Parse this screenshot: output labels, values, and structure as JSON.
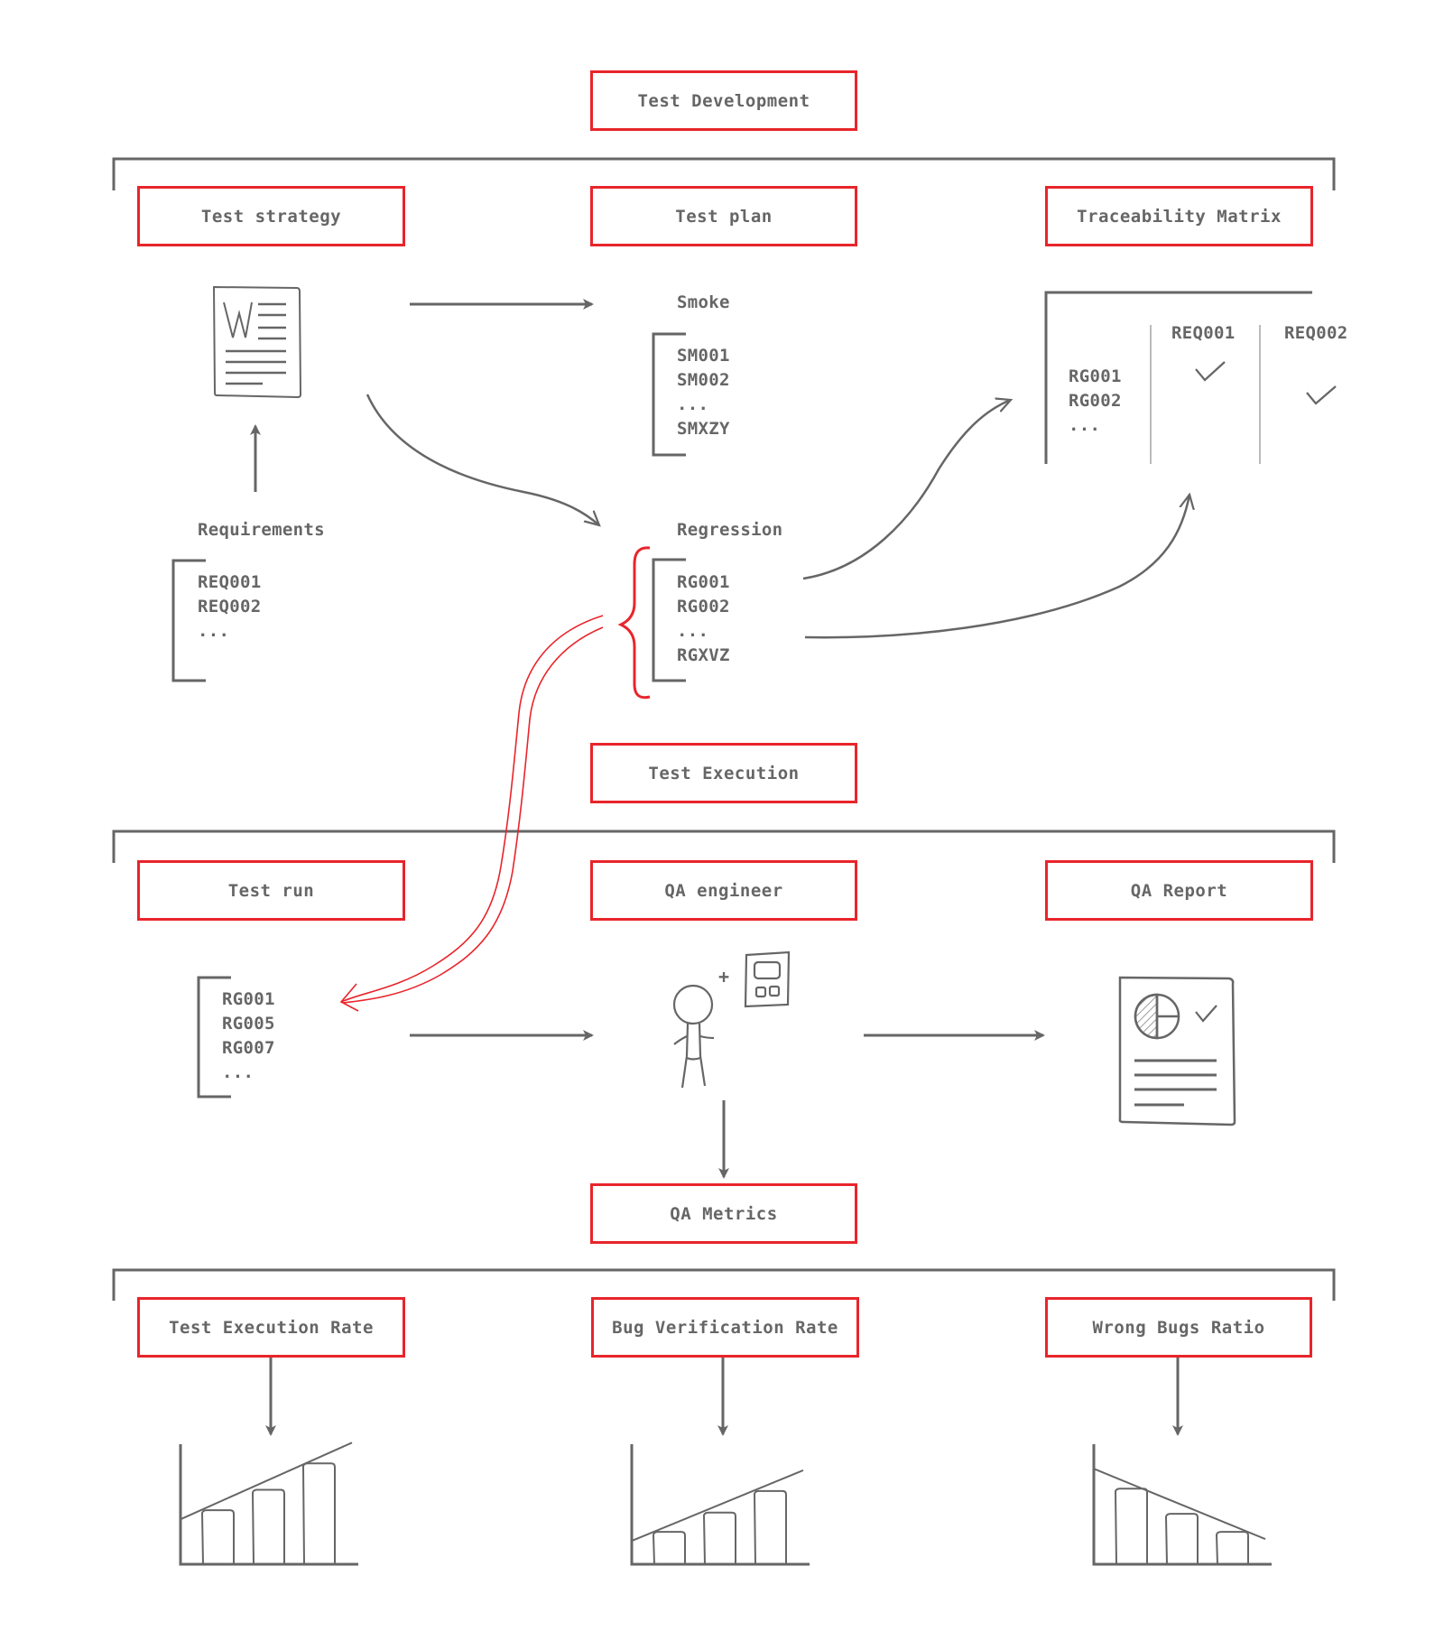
{
  "colors": {
    "accent": "#e8252b",
    "ink": "#666666",
    "light_ink": "#bbbbbb"
  },
  "sections": {
    "test_development": {
      "label": "Test Development"
    },
    "test_execution": {
      "label": "Test Execution"
    },
    "qa_metrics": {
      "label": "QA Metrics"
    }
  },
  "development": {
    "test_strategy": {
      "label": "Test strategy",
      "icon": "word-document-icon"
    },
    "test_plan": {
      "label": "Test plan"
    },
    "traceability_matrix": {
      "label": "Traceability Matrix"
    },
    "requirements": {
      "title": "Requirements",
      "items": [
        "REQ001",
        "REQ002",
        "..."
      ]
    },
    "smoke": {
      "title": "Smoke",
      "items": [
        "SM001",
        "SM002",
        "...",
        "SMXZY"
      ]
    },
    "regression": {
      "title": "Regression",
      "items": [
        "RG001",
        "RG002",
        "...",
        "RGXVZ"
      ]
    },
    "matrix": {
      "columns": [
        "REQ001",
        "REQ002"
      ],
      "rows": [
        "RG001",
        "RG002",
        "..."
      ],
      "checks": [
        {
          "row": "RG001",
          "column": "REQ001",
          "checked": true
        },
        {
          "row": "RG002",
          "column": "REQ002",
          "checked": true
        }
      ]
    }
  },
  "execution": {
    "test_run": {
      "label": "Test run",
      "items": [
        "RG001",
        "RG005",
        "RG007",
        "..."
      ]
    },
    "qa_engineer": {
      "label": "QA engineer",
      "plus": "+",
      "icon": "person-with-calculator-icon"
    },
    "qa_report": {
      "label": "QA Report",
      "icon": "report-document-icon"
    }
  },
  "metrics": [
    {
      "label": "Test Execution Rate",
      "trend": "increasing",
      "bars": [
        0.45,
        0.62,
        0.84
      ]
    },
    {
      "label": "Bug Verification Rate",
      "trend": "increasing",
      "bars": [
        0.27,
        0.43,
        0.61
      ]
    },
    {
      "label": "Wrong Bugs Ratio",
      "trend": "decreasing",
      "bars": [
        0.63,
        0.42,
        0.27
      ]
    }
  ]
}
